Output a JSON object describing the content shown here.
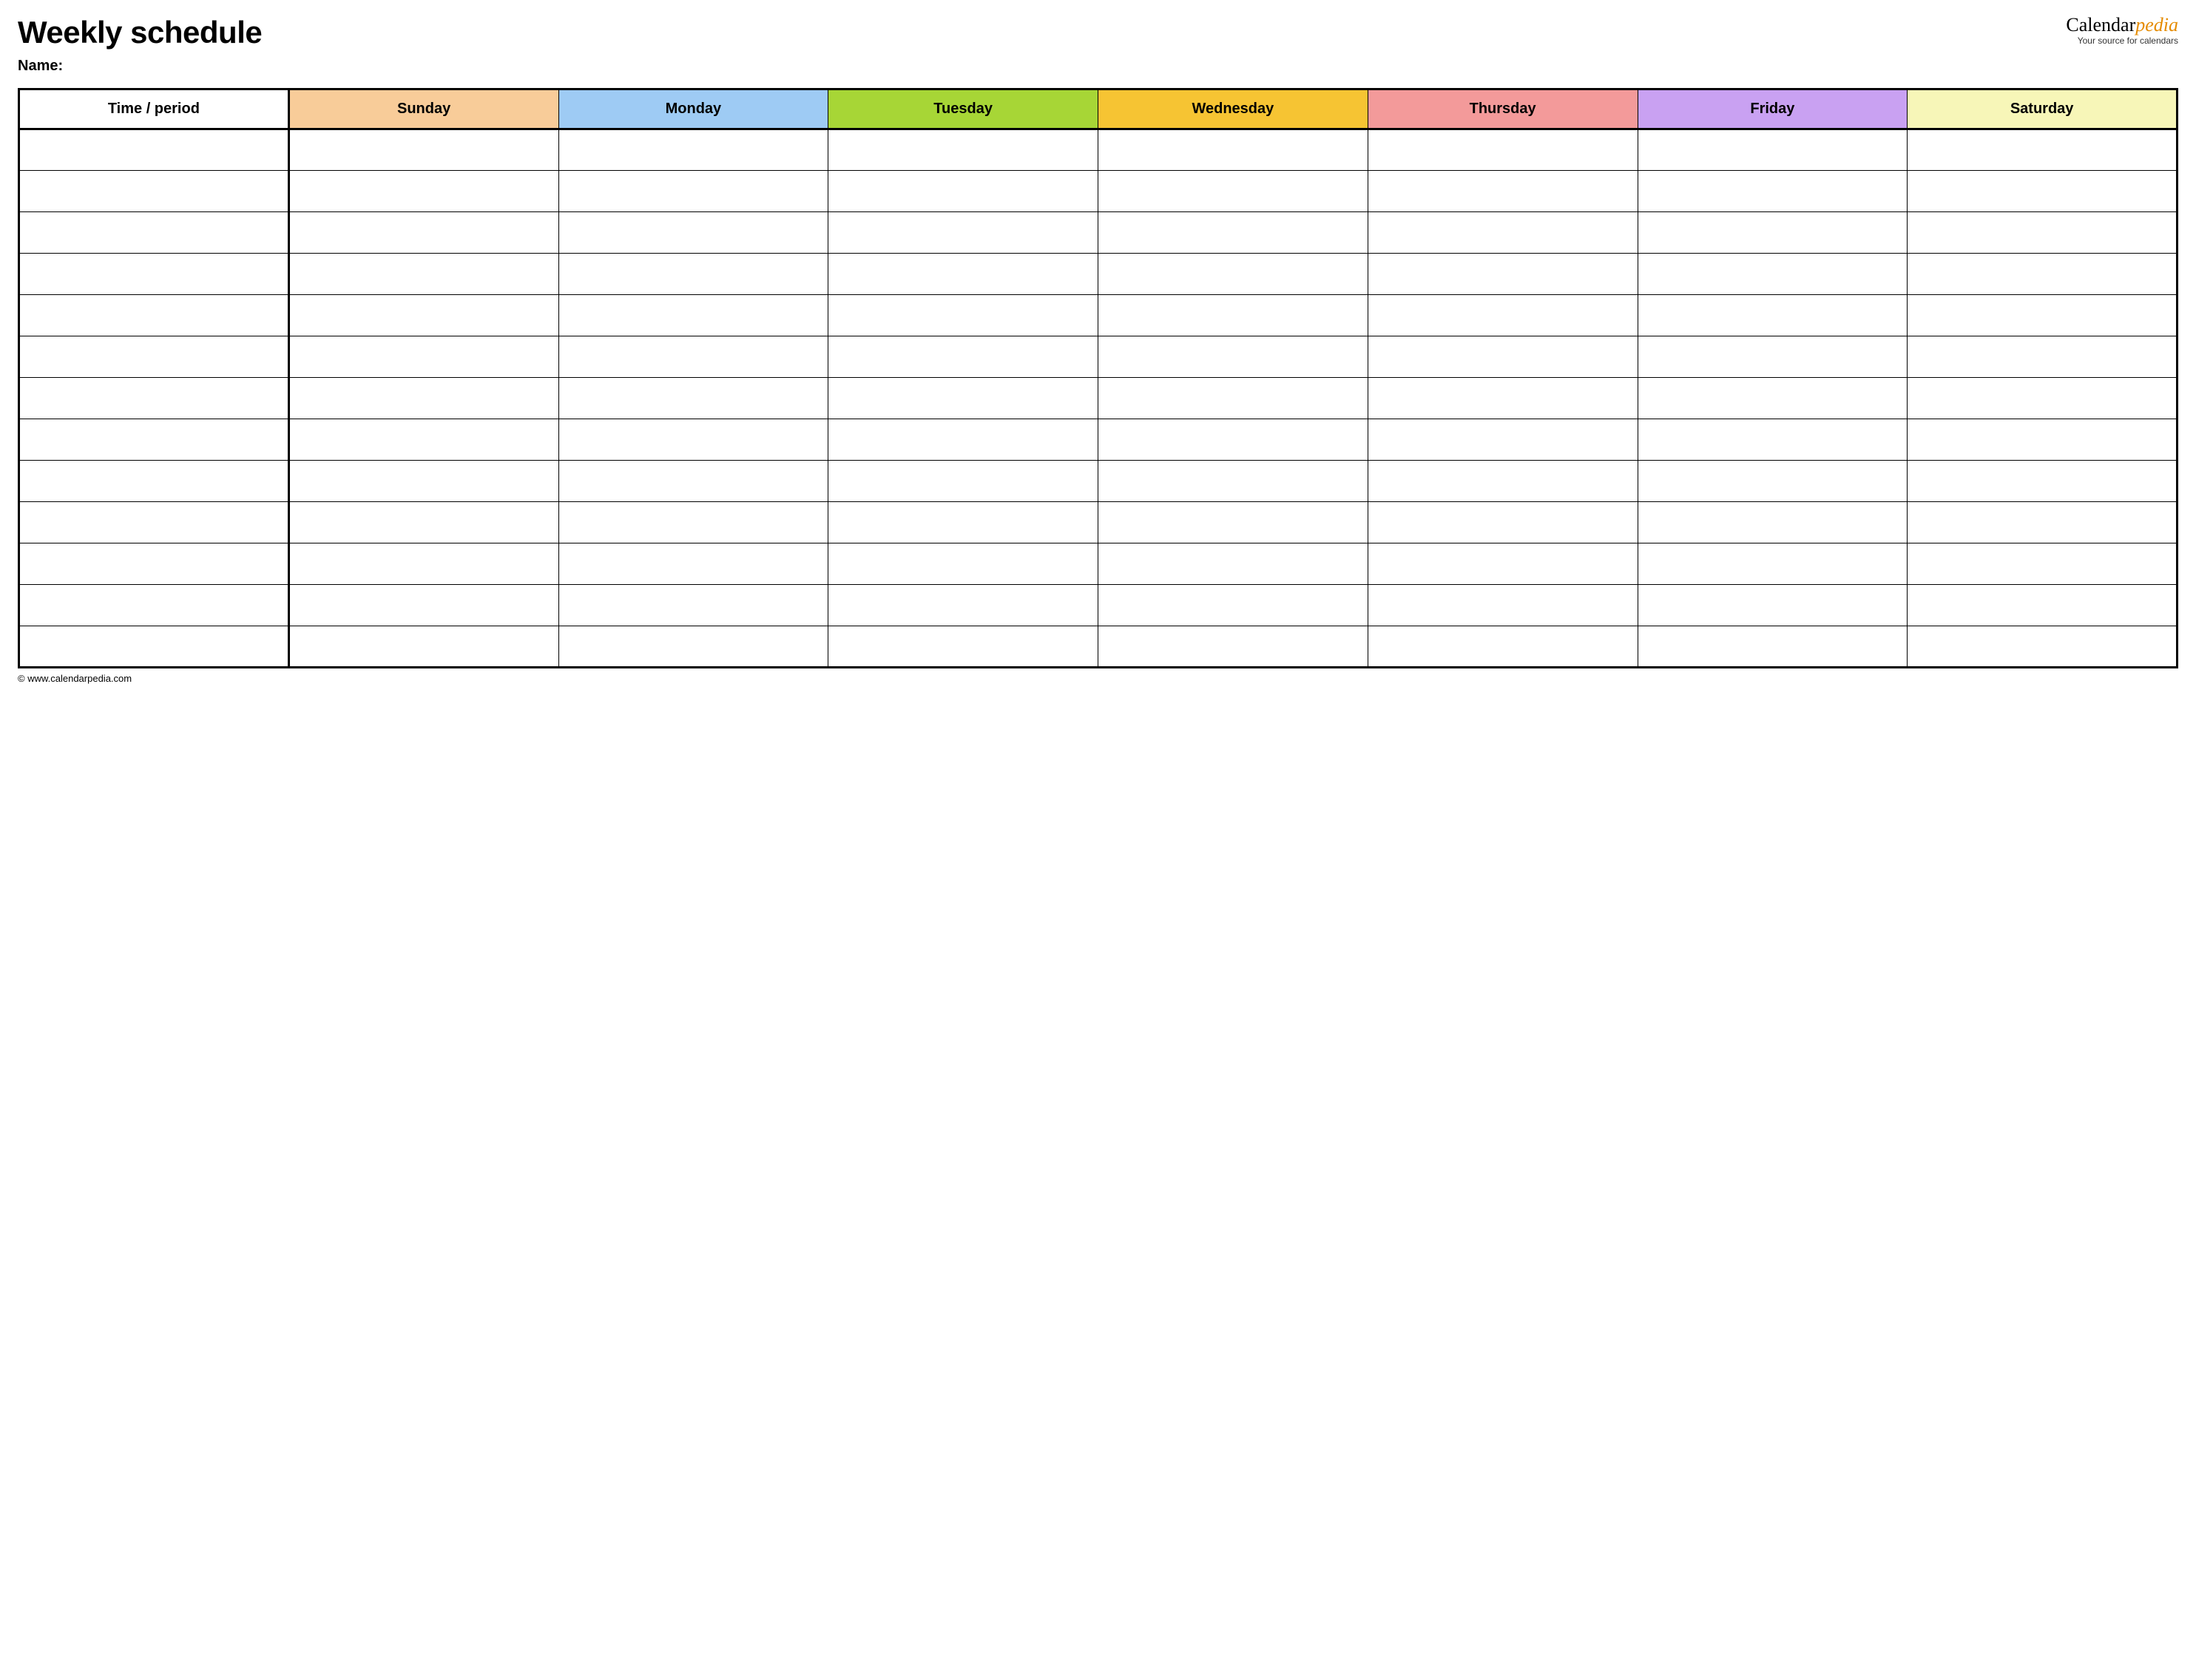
{
  "header": {
    "title": "Weekly schedule",
    "name_label": "Name:"
  },
  "brand": {
    "name_part1": "Calendar",
    "name_part2": "pedia",
    "tagline": "Your source for calendars"
  },
  "table": {
    "columns": [
      {
        "label": "Time / period",
        "bg": "#ffffff"
      },
      {
        "label": "Sunday",
        "bg": "#f8cc99"
      },
      {
        "label": "Monday",
        "bg": "#9ecbf4"
      },
      {
        "label": "Tuesday",
        "bg": "#a7d636"
      },
      {
        "label": "Wednesday",
        "bg": "#f6c433"
      },
      {
        "label": "Thursday",
        "bg": "#f39a9a"
      },
      {
        "label": "Friday",
        "bg": "#c9a1f2"
      },
      {
        "label": "Saturday",
        "bg": "#f7f6b8"
      }
    ],
    "row_count": 13
  },
  "footer": {
    "copyright": "© www.calendarpedia.com"
  }
}
